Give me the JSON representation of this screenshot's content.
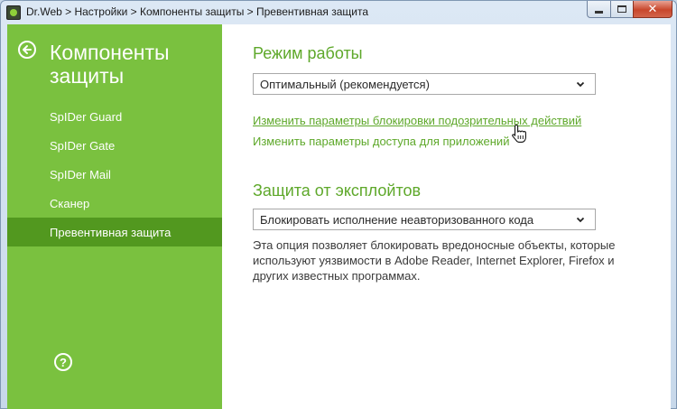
{
  "window": {
    "breadcrumb": "Dr.Web > Настройки > Компоненты защиты > Превентивная защита",
    "controls": {
      "minimize": "minimize",
      "maximize": "maximize",
      "close": "✕"
    }
  },
  "sidebar": {
    "title": "Компоненты защиты",
    "items": [
      {
        "label": "SpIDer Guard"
      },
      {
        "label": "SpIDer Gate"
      },
      {
        "label": "SpIDer Mail"
      },
      {
        "label": "Сканер"
      },
      {
        "label": "Превентивная защита",
        "active": true
      }
    ],
    "help_label": "?"
  },
  "main": {
    "mode_section": {
      "title": "Режим работы",
      "select_value": "Оптимальный (рекомендуется)",
      "link_block_settings": "Изменить параметры блокировки подозрительных действий",
      "link_app_access": "Изменить параметры доступа для приложений"
    },
    "exploit_section": {
      "title": "Защита от эксплойтов",
      "select_value": "Блокировать исполнение неавторизованного кода",
      "description": "Эта опция позволяет блокировать вредоносные объекты, которые используют уязвимости в Adobe Reader, Internet Explorer, Firefox и других известных программах."
    }
  },
  "colors": {
    "sidebar_bg": "#7ac13f",
    "sidebar_active": "#52981f",
    "accent_green": "#5ea82a"
  },
  "icons": {
    "back": "arrow-left-circle-icon",
    "help": "question-circle-icon",
    "dropdown": "chevron-down-icon",
    "cursor": "hand-pointer-icon"
  }
}
